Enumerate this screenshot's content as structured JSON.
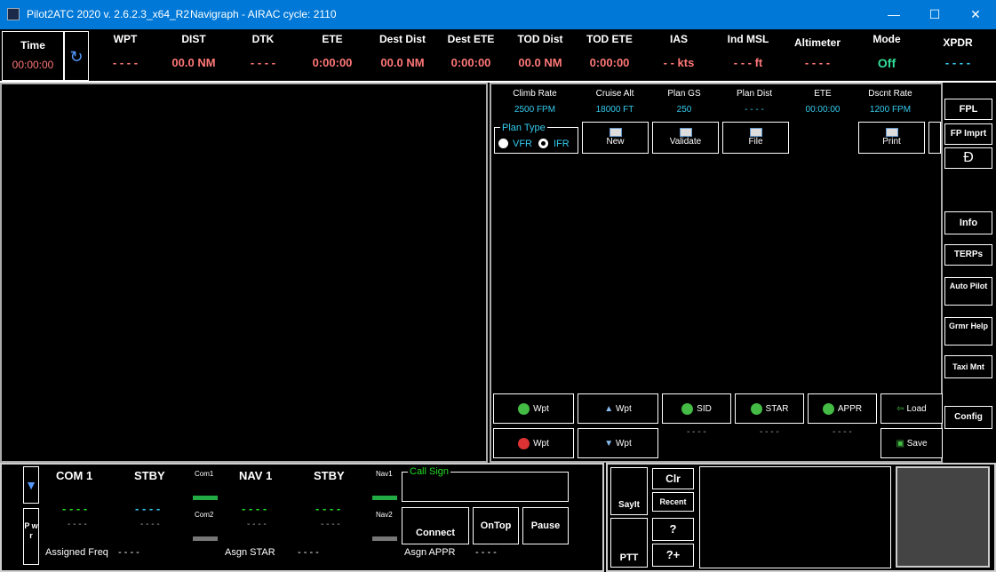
{
  "window": {
    "title": "Pilot2ATC 2020 v. 2.6.2.3_x64_R2",
    "subtitle": "Navigraph - AIRAC cycle: 2110",
    "minimize": "—",
    "maximize": "☐",
    "close": "✕"
  },
  "topbar": {
    "time_label": "Time",
    "time_value": "00:00:00",
    "fields": [
      {
        "label": "WPT",
        "value": "- - - -"
      },
      {
        "label": "DIST",
        "value": "00.0 NM"
      },
      {
        "label": "DTK",
        "value": "- - - -"
      },
      {
        "label": "ETE",
        "value": "0:00:00"
      },
      {
        "label": "Dest Dist",
        "value": "00.0 NM"
      },
      {
        "label": "Dest ETE",
        "value": "0:00:00"
      },
      {
        "label": "TOD Dist",
        "value": "00.0 NM"
      },
      {
        "label": "TOD ETE",
        "value": "0:00:00"
      },
      {
        "label": "IAS",
        "value": "- - kts"
      },
      {
        "label": "Ind MSL",
        "value": "- - - ft"
      },
      {
        "label": "Altimeter",
        "value": "- - - -"
      },
      {
        "label": "Mode",
        "value": "Off"
      },
      {
        "label": "XPDR",
        "value": "- - - -"
      }
    ]
  },
  "plan": {
    "stats": [
      {
        "label": "Climb Rate",
        "value": "2500 FPM"
      },
      {
        "label": "Cruise Alt",
        "value": "18000 FT"
      },
      {
        "label": "Plan GS",
        "value": "250"
      },
      {
        "label": "Plan Dist",
        "value": "- - - -"
      },
      {
        "label": "ETE",
        "value": "00:00:00"
      },
      {
        "label": "Dscnt Rate",
        "value": "1200 FPM"
      }
    ],
    "plan_type_label": "Plan Type",
    "vfr": "VFR",
    "ifr": "IFR",
    "new": "New",
    "validate": "Validate",
    "file": "File",
    "print": "Print",
    "add_wpt": "Wpt",
    "up_wpt": "Wpt",
    "sid": "SID",
    "star": "STAR",
    "appr": "APPR",
    "load": "Load",
    "del_wpt": "Wpt",
    "down_wpt": "Wpt",
    "save": "Save",
    "sid_val": "- - - -",
    "star_val": "- - - -",
    "appr_val": "- - - -"
  },
  "side": {
    "fpl": "FPL",
    "fp_imprt": "FP Imprt",
    "info": "Info",
    "terps": "TERPs",
    "auto_pilot": "Auto Pilot",
    "grmr_help": "Grmr Help",
    "taxi_mnt": "Taxi Mnt",
    "config": "Config"
  },
  "radio": {
    "com1": "COM 1",
    "stby1": "STBY",
    "nav1": "NAV 1",
    "stby2": "STBY",
    "com1_freq": "- - - -",
    "com1_stby": "- - - -",
    "nav1_freq": "- - - -",
    "nav1_stby": "- - - -",
    "com1_sub": "- - - -",
    "com1_stby_sub": "- - - -",
    "nav1_sub": "- - - -",
    "nav1_stby_sub": "- - - -",
    "com1_tag": "Com1",
    "com2_tag": "Com2",
    "nav1_tag": "Nav1",
    "nav2_tag": "Nav2",
    "pwr": "P w r",
    "assigned_freq_label": "Assigned Freq",
    "assigned_freq": "- - - -",
    "asgn_star_label": "Asgn STAR",
    "asgn_star": "- - - -",
    "asgn_appr_label": "Asgn APPR",
    "asgn_appr": "- - - -",
    "call_sign_label": "Call Sign",
    "connect": "Connect",
    "ontop": "OnTop",
    "pause": "Pause"
  },
  "speech": {
    "sayit": "SayIt",
    "ptt": "PTT",
    "clr": "Clr",
    "recent": "Recent",
    "q": "?",
    "qplus": "?+"
  }
}
